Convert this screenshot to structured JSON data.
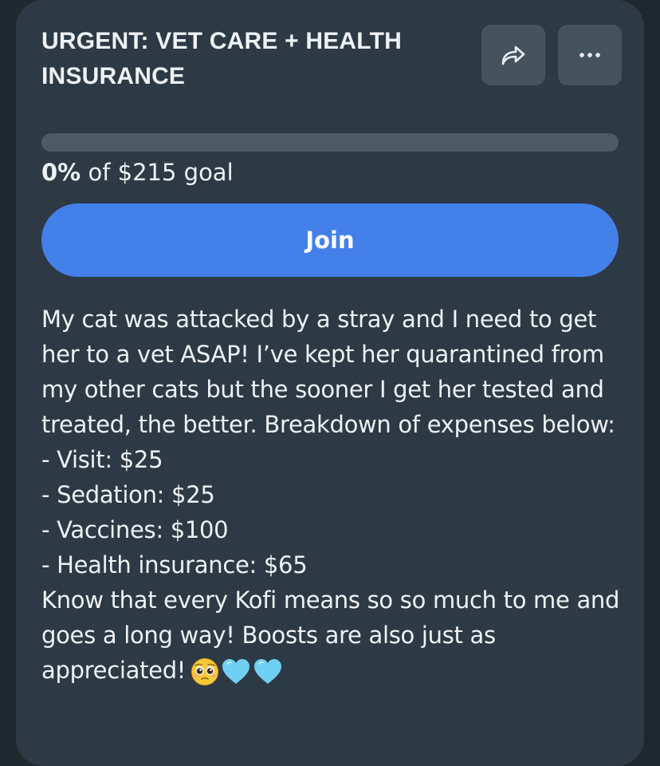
{
  "post": {
    "title": "URGENT: VET CARE + HEALTH INSURANCE",
    "share_icon": "share-forward-icon",
    "more_icon": "more-horizontal-icon"
  },
  "goal": {
    "progress_fraction": 0,
    "percent_text": "0%",
    "goal_text": " of $215 goal"
  },
  "actions": {
    "join_label": "Join"
  },
  "description": {
    "intro": "My cat was attacked by a stray and I need to get her to a vet ASAP! I’ve kept her quarantined from my other cats but the sooner I get her tested and treated, the better. Breakdown of expenses below:",
    "expenses": [
      "- Visit: $25",
      "- Sedation: $25",
      "- Vaccines: $100",
      "- Health insurance: $65"
    ],
    "closing": "Know that every Kofi means so so much to me and goes a long way! Boosts are also just as appreciated!",
    "emojis": [
      "pleading-face-emoji",
      "light-blue-heart-emoji",
      "light-blue-heart-emoji"
    ]
  },
  "colors": {
    "card_background": "#2d3a45",
    "accent": "#4480ea",
    "icon_button": "#45535f"
  }
}
